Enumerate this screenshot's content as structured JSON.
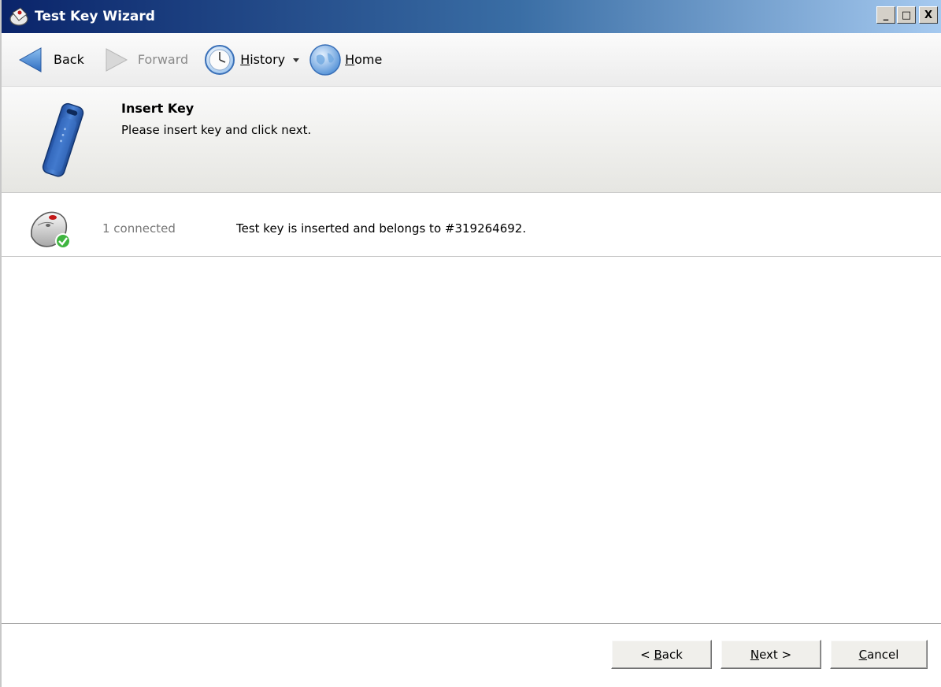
{
  "window": {
    "title": "Test Key Wizard",
    "minimize_glyph": "_",
    "maximize_glyph": "□",
    "close_glyph": "X"
  },
  "nav": {
    "back": "Back",
    "forward": "Forward",
    "history_label": "History",
    "history_rest": "istory",
    "history_first": "H",
    "home_first": "H",
    "home_rest": "ome",
    "home": "Home"
  },
  "header": {
    "title": "Insert Key",
    "subtitle": "Please insert key and click next."
  },
  "status": {
    "count": "1 connected",
    "message": "Test key is inserted and belongs to #319264692."
  },
  "buttons": {
    "back_prefix": "< ",
    "back_access": "B",
    "back_rest": "ack",
    "next_access": "N",
    "next_rest": "ext >",
    "cancel_access": "C",
    "cancel_rest": "ancel"
  },
  "icons": {
    "title": "key-wizard-icon",
    "back": "back-arrow-icon",
    "forward": "forward-arrow-icon",
    "history": "clock-icon",
    "history_dropdown": "dropdown-arrow-icon",
    "home": "globe-icon",
    "header": "usb-key-icon",
    "status": "key-reader-connected-icon"
  },
  "colors": {
    "titlebar_start": "#0a246a",
    "titlebar_end": "#a6caf0",
    "back_arrow": "#3f7fc8",
    "forward_arrow": "#c4c4c4",
    "key_blue": "#2a5fb5",
    "check_green": "#3fb540"
  }
}
